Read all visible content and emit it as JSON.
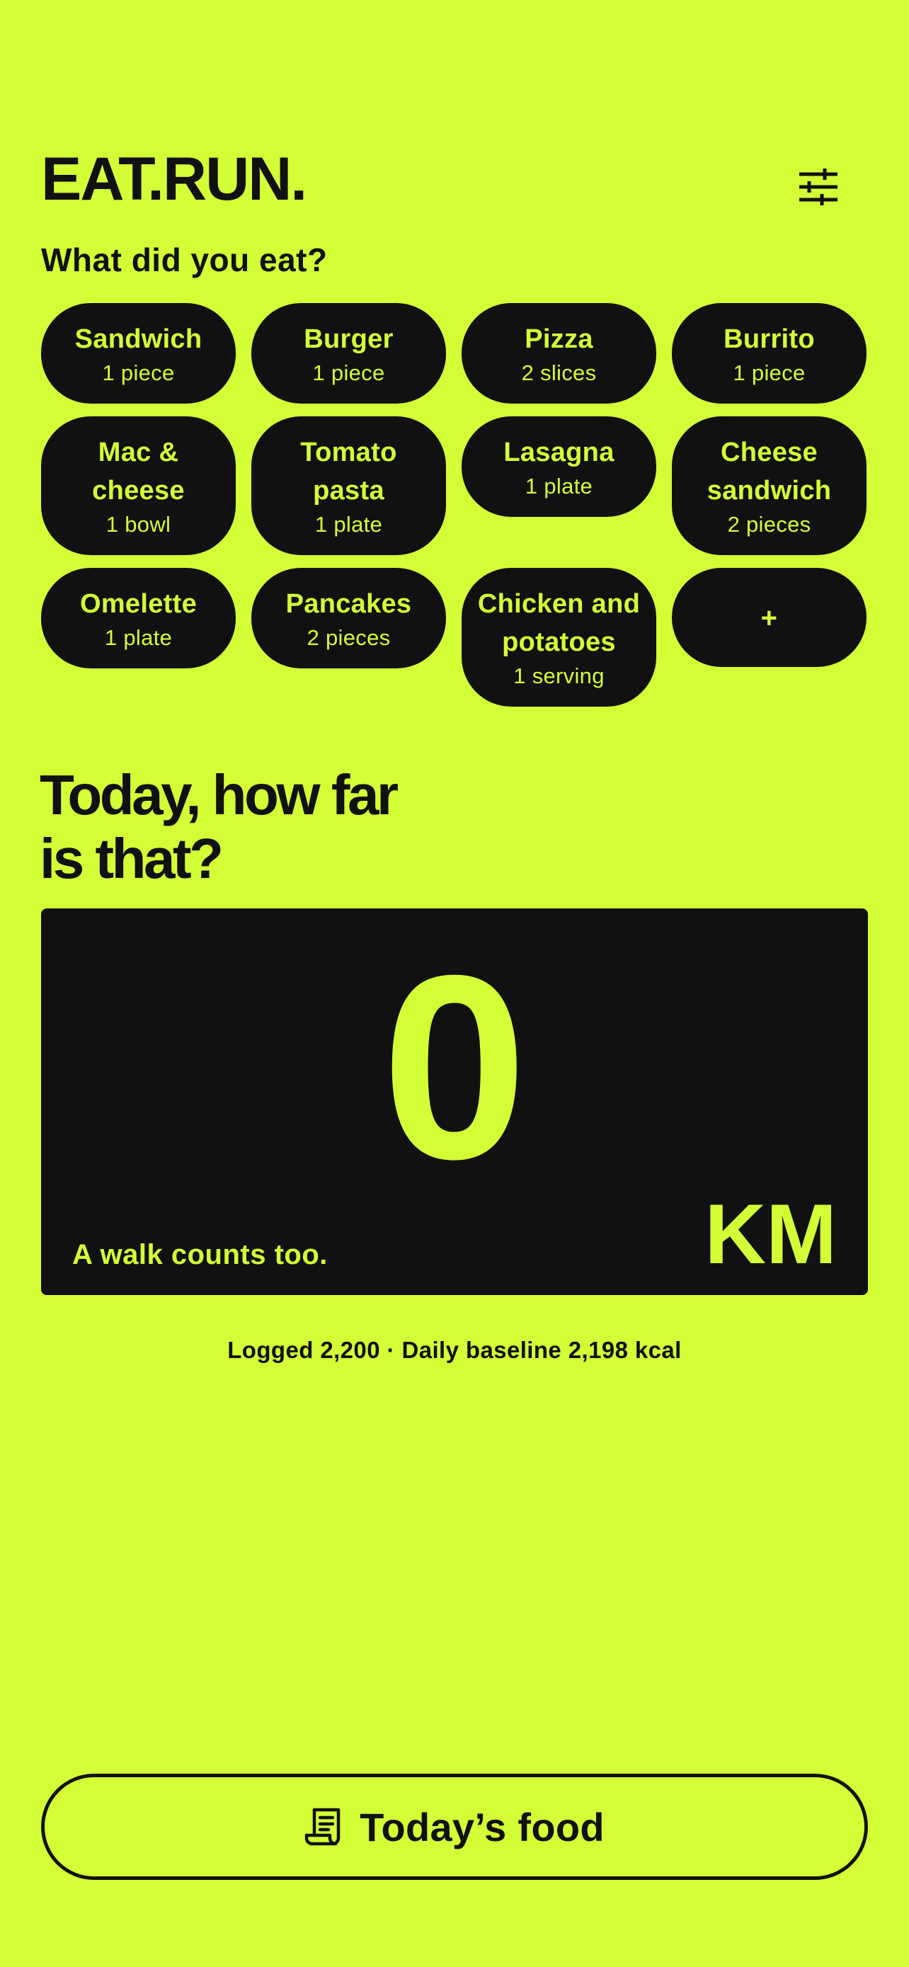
{
  "header": {
    "title": "EAT.RUN.",
    "settings_icon": "sliders-icon"
  },
  "food_section": {
    "prompt": "What did you eat?",
    "items": [
      {
        "name": "Sandwich",
        "qty": "1 piece"
      },
      {
        "name": "Burger",
        "qty": "1 piece"
      },
      {
        "name": "Pizza",
        "qty": "2 slices"
      },
      {
        "name": "Burrito",
        "qty": "1 piece"
      },
      {
        "name": "Mac & cheese",
        "qty": "1 bowl"
      },
      {
        "name": "Tomato pasta",
        "qty": "1 plate"
      },
      {
        "name": "Lasagna",
        "qty": "1 plate"
      },
      {
        "name": "Cheese sandwich",
        "qty": "2 pieces"
      },
      {
        "name": "Omelette",
        "qty": "1 plate"
      },
      {
        "name": "Pancakes",
        "qty": "2 pieces"
      },
      {
        "name": "Chicken and potatoes",
        "qty": "1 serving"
      }
    ],
    "add_label": "+"
  },
  "distance": {
    "heading": "Today, how far is that?",
    "value": "0",
    "unit": "KM",
    "hint": "A walk counts too."
  },
  "summary": "Logged 2,200 · Daily baseline 2,198 kcal",
  "footer": {
    "button_label": "Today’s food",
    "button_icon": "receipt-icon"
  },
  "colors": {
    "background": "#d4ff36",
    "ink": "#111111",
    "accent": "#d4ff36"
  }
}
